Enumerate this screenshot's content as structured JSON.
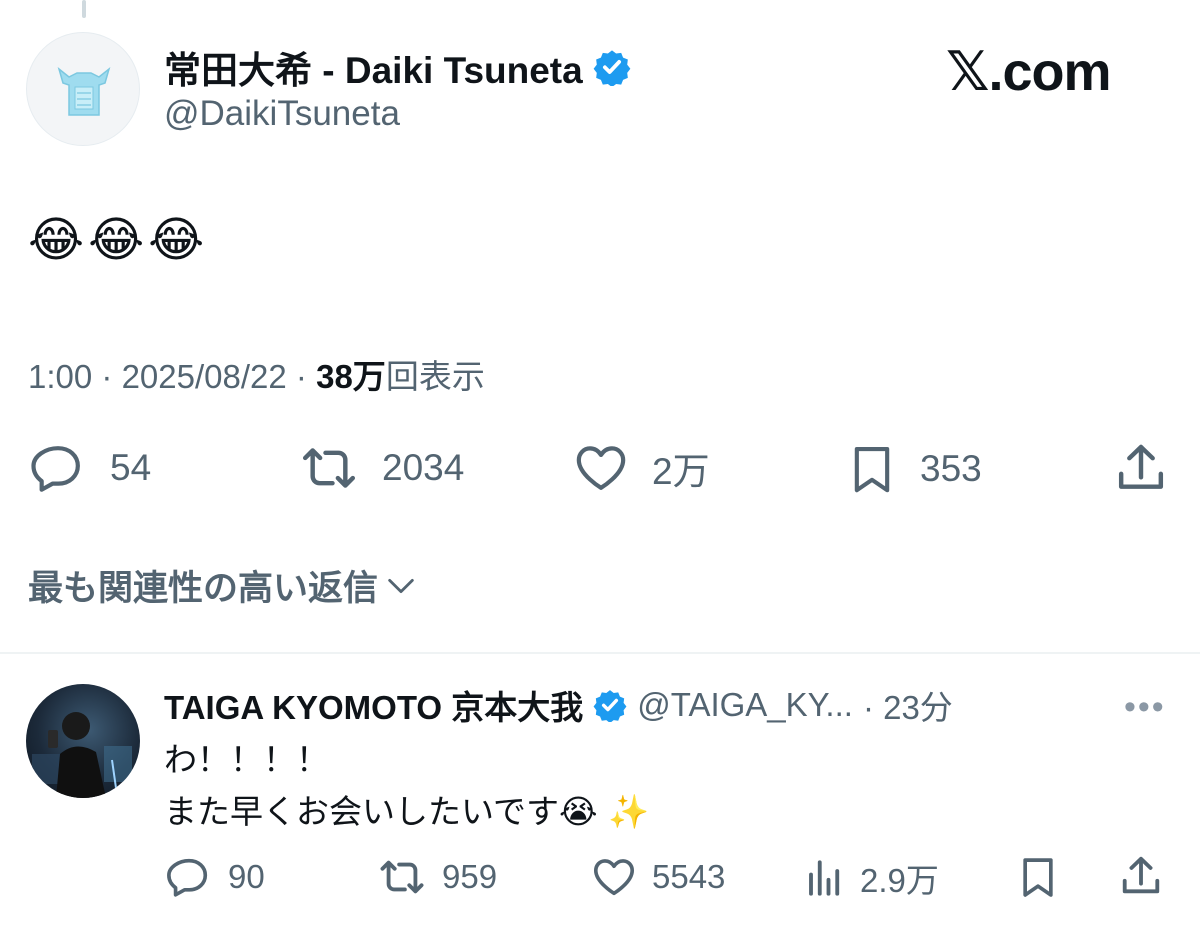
{
  "main_tweet": {
    "display_name": "常田大希 - Daiki Tsuneta",
    "handle": "@DaikiTsuneta",
    "text": "😂😂😂",
    "time": "1:00",
    "separator": "·",
    "date": "2025/08/22",
    "views_count": "38万",
    "views_label": "回表示",
    "stats": {
      "replies": "54",
      "retweets": "2034",
      "likes": "2万",
      "bookmarks": "353"
    }
  },
  "brand": {
    "x": "𝕏",
    "domain": ".com"
  },
  "replies_sort_label": "最も関連性の高い返信",
  "reply": {
    "display_name": "TAIGA KYOMOTO 京本大我",
    "handle": "@TAIGA_KY...",
    "time": "· 23分",
    "more": "•••",
    "line1": "わ！！！！",
    "line2": "また早くお会いしたいです",
    "line2_emoji": "😭 ✨",
    "stats": {
      "replies": "90",
      "retweets": "959",
      "likes": "5543",
      "views": "2.9万"
    }
  },
  "colors": {
    "text": "#0f1419",
    "secondary": "#536471",
    "verified": "#1d9bf0",
    "divider": "#eff3f4"
  },
  "icons": [
    "reply-icon",
    "retweet-icon",
    "like-icon",
    "bookmark-icon",
    "share-icon",
    "views-icon",
    "verified-badge-icon",
    "chevron-down-icon",
    "more-icon"
  ]
}
